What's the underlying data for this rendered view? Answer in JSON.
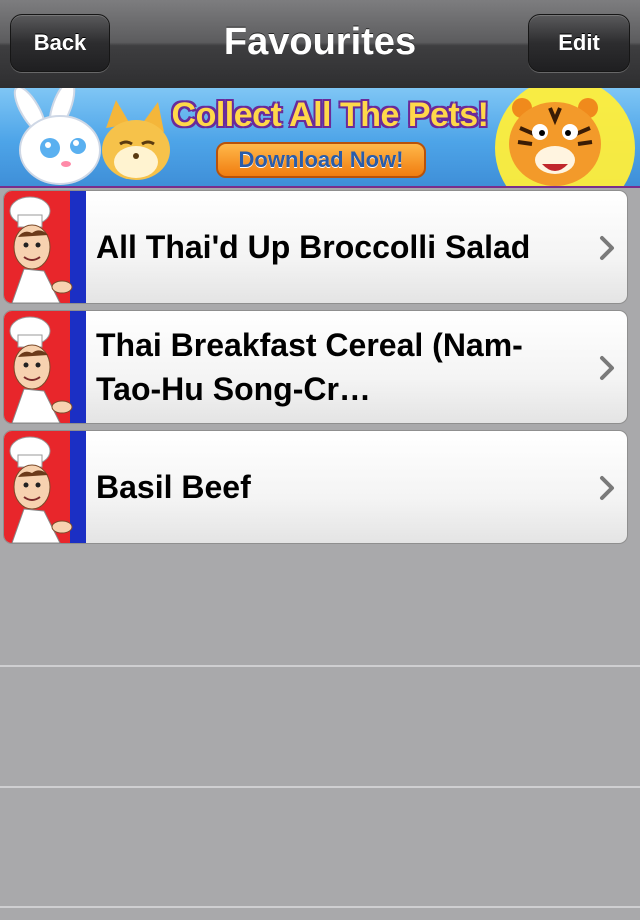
{
  "nav": {
    "title": "Favourites",
    "back_label": "Back",
    "edit_label": "Edit"
  },
  "ad": {
    "headline": "Collect All The Pets!",
    "cta": "Download Now!"
  },
  "favourites": [
    {
      "title": "All Thai'd Up Broccolli Salad",
      "icon": "chef-icon"
    },
    {
      "title": "Thai Breakfast Cereal (Nam-Tao-Hu Song-Cr…",
      "icon": "chef-icon"
    },
    {
      "title": "Basil Beef",
      "icon": "chef-icon"
    }
  ],
  "colors": {
    "navbar": "#3e3e40",
    "background": "#a9a9ab",
    "thumb_red": "#e8262b",
    "thumb_blue": "#1b2fc4",
    "ad_sky": "#4da4e8",
    "ad_purple": "#6a2a9a"
  }
}
